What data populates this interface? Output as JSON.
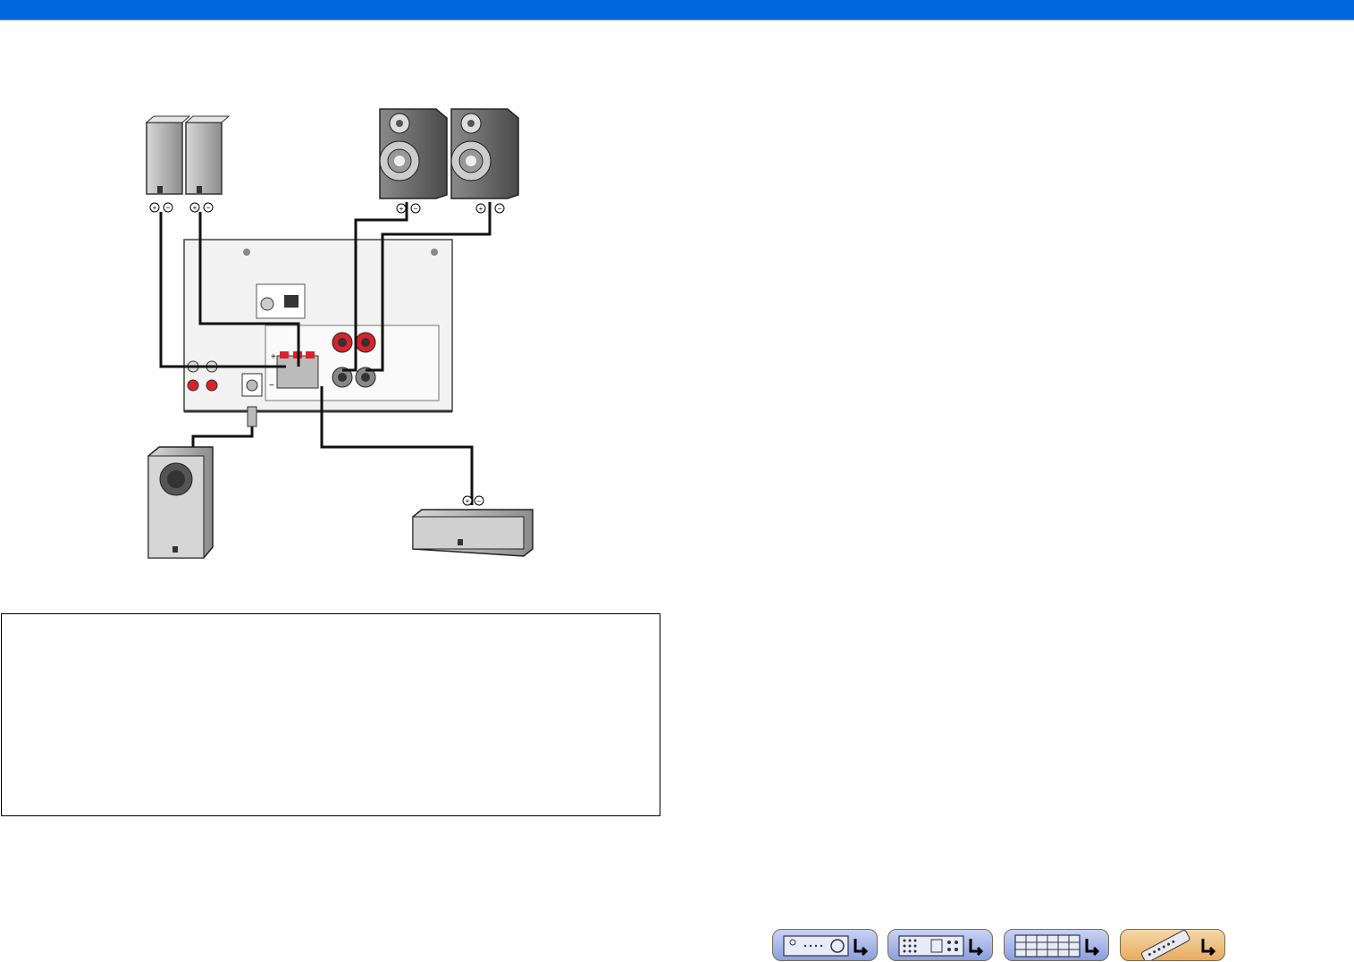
{
  "header": {
    "bar_color": "#0066dd"
  },
  "diagram": {
    "title": "",
    "terminal_marks": {
      "plus": "+",
      "minus": "−"
    },
    "icons": [
      "speaker-icon",
      "subwoofer-icon",
      "center-speaker-icon",
      "receiver-rear-panel-icon"
    ]
  },
  "note_box": {
    "text": ""
  },
  "nav_buttons": [
    {
      "icon": "front-panel-icon",
      "style": "blue"
    },
    {
      "icon": "rear-panel-icon",
      "style": "blue"
    },
    {
      "icon": "menu-list-icon",
      "style": "blue"
    },
    {
      "icon": "remote-control-icon",
      "style": "orange"
    }
  ],
  "colors": {
    "accent": "#0066dd",
    "terminal_red": "#d9222a",
    "nav_blue": "#8a9fe0",
    "nav_orange": "#e6ab5f"
  }
}
